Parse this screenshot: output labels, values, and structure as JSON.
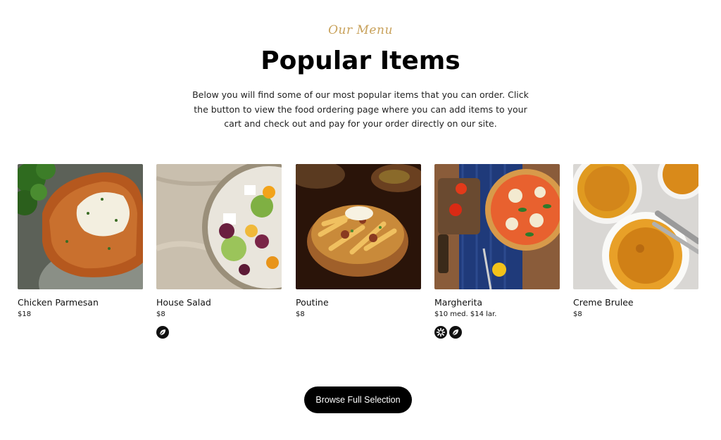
{
  "section": {
    "eyebrow": "Our Menu",
    "title": "Popular Items",
    "description": "Below you will find some of our most popular items that you can order. Click the button to view the food ordering page where you can add items to your cart and check out and pay for your order directly on our site."
  },
  "items": [
    {
      "name": "Chicken Parmesan",
      "price": "$18",
      "badges": []
    },
    {
      "name": "House Salad",
      "price": "$8",
      "badges": [
        "leaf-icon"
      ]
    },
    {
      "name": "Poutine",
      "price": "$8",
      "badges": []
    },
    {
      "name": "Margherita",
      "price": "$10 med.  $14 lar.",
      "badges": [
        "grain-free-icon",
        "leaf-icon"
      ]
    },
    {
      "name": "Creme Brulee",
      "price": "$8",
      "badges": []
    }
  ],
  "cta": {
    "label": "Browse Full Selection"
  },
  "colors": {
    "accent": "#c8a15a",
    "button_bg": "#000000",
    "button_text": "#ffffff",
    "badge_bg": "#111111"
  }
}
